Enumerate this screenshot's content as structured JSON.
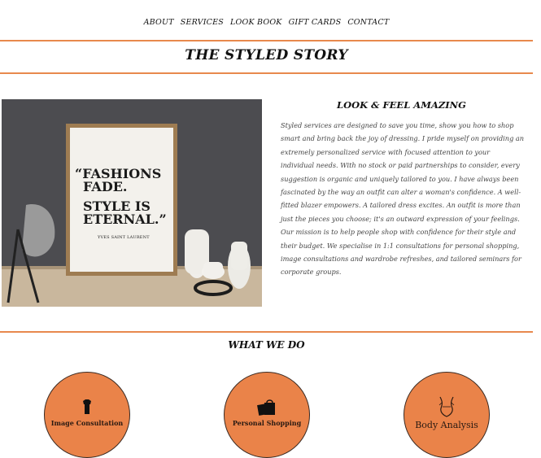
{
  "nav": {
    "items": [
      "About",
      "Services",
      "Look Book",
      "Gift Cards",
      "Contact"
    ]
  },
  "header": {
    "title": "THE STYLED STORY"
  },
  "hero": {
    "poster_line1": "“FASHIONS",
    "poster_line2": "FADE.",
    "poster_line3": "STYLE IS",
    "poster_line4": "ETERNAL.”",
    "poster_credit": "YVES SAINT LAURENT"
  },
  "about": {
    "heading": "LOOK & FEEL AMAZING",
    "body": "Styled services are designed to save you time, show you how to shop smart and bring back the joy of dressing. I pride myself on providing an extremely personalized service with focused attention to your individual needs. With no stock or paid partnerships to consider, every suggestion is organic and uniquely tailored to you. I have always been fascinated by the way an outfit can alter a woman's confidence. A well-fitted blazer empowers. A tailored dress excites. An outfit is more than just the pieces you choose; it's an outward expression of your feelings. Our mission is to help people shop with confidence for their style and their budget. We specialise in 1:1 consultations for personal shopping, image consultations and wardrobe refreshes, and tailored seminars for corporate groups."
  },
  "services": {
    "heading": "WHAT WE DO",
    "items": [
      {
        "label": "Image Consultation",
        "icon": "shirt-icon"
      },
      {
        "label": "Personal Shopping",
        "icon": "shopping-bags-icon"
      },
      {
        "label": "Body Analysis",
        "icon": "body-silhouette-icon"
      }
    ]
  },
  "colors": {
    "accent": "#ea8349",
    "rule": "#e8894d",
    "text": "#111111"
  }
}
